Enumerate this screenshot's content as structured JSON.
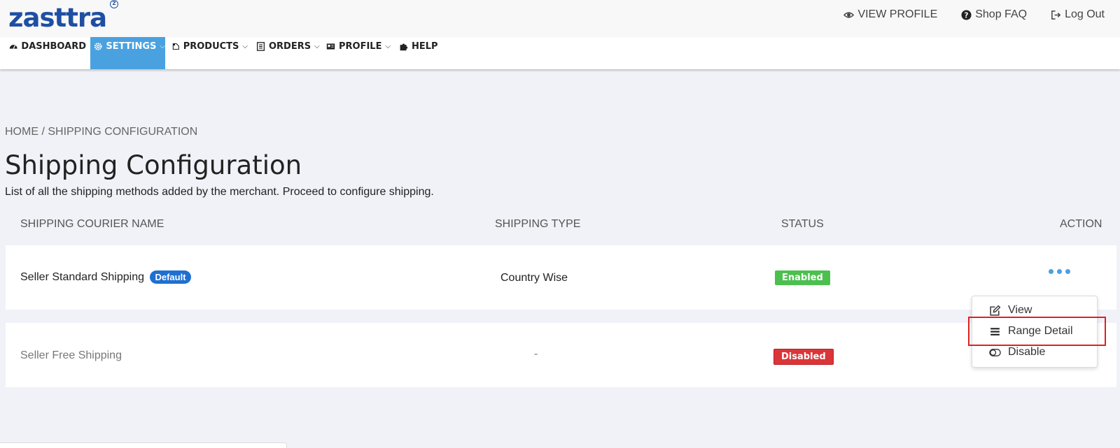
{
  "brand": {
    "logo_text": "zasttra",
    "logo_mark": "Z"
  },
  "toplinks": [
    {
      "label": "VIEW PROFILE",
      "icon": "eye-icon"
    },
    {
      "label": "Shop FAQ",
      "icon": "question-circle-icon"
    },
    {
      "label": "Log Out",
      "icon": "logout-icon"
    }
  ],
  "nav": [
    {
      "label": "DASHBOARD",
      "icon": "dashboard-icon"
    },
    {
      "label": "SETTINGS",
      "icon": "gear-icon",
      "active": true
    },
    {
      "label": "PRODUCTS",
      "icon": "products-icon"
    },
    {
      "label": "ORDERS",
      "icon": "orders-icon"
    },
    {
      "label": "PROFILE",
      "icon": "profile-card-icon"
    },
    {
      "label": "HELP",
      "icon": "puzzle-icon"
    }
  ],
  "breadcrumb": "HOME / SHIPPING CONFIGURATION",
  "page": {
    "title": "Shipping Configuration",
    "subtitle": "List of all the shipping methods added by the merchant. Proceed to configure shipping."
  },
  "table": {
    "headers": [
      "SHIPPING COURIER NAME",
      "SHIPPING TYPE",
      "STATUS",
      "ACTION"
    ],
    "rows": [
      {
        "name": "Seller Standard Shipping",
        "badge": "Default",
        "type": "Country Wise",
        "status": "Enabled"
      },
      {
        "name": "Seller Free Shipping",
        "badge": "",
        "type": "-",
        "status": "Disabled"
      }
    ]
  },
  "action_menu": {
    "items": [
      {
        "label": "View",
        "icon": "edit-icon"
      },
      {
        "label": "Range Detail",
        "icon": "list-icon"
      },
      {
        "label": "Disable",
        "icon": "toggle-icon"
      }
    ],
    "highlighted": "Range Detail"
  },
  "colors": {
    "brand": "#1e4fa3",
    "nav_active": "#4aa1e0",
    "enabled": "#4cbf4f",
    "disabled": "#dc3538",
    "default_badge": "#1f6fd0",
    "highlight_box": "#e02020"
  }
}
